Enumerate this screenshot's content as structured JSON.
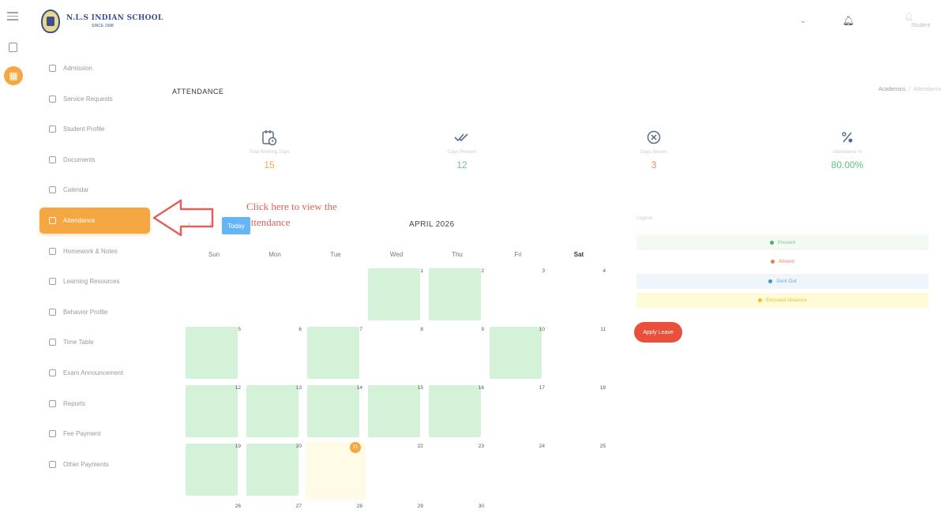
{
  "school": {
    "name": "N.L.S INDIAN SCHOOL",
    "subtitle": "SINCE 1998"
  },
  "topbar": {
    "caret": "⌄",
    "user_name": "Student"
  },
  "sidebar": {
    "items": [
      {
        "label": "Admission",
        "icon": "admission-icon",
        "active": false
      },
      {
        "label": "Service Requests",
        "icon": "service-icon",
        "active": false
      },
      {
        "label": "Student Profile",
        "icon": "profile-icon",
        "active": false
      },
      {
        "label": "Documents",
        "icon": "documents-icon",
        "active": false
      },
      {
        "label": "Calendar",
        "icon": "calendar-icon",
        "active": false
      },
      {
        "label": "Attendance",
        "icon": "attendance-icon",
        "active": true
      },
      {
        "label": "Homework & Notes",
        "icon": "homework-icon",
        "active": false
      },
      {
        "label": "Learning Resources",
        "icon": "resources-icon",
        "active": false
      },
      {
        "label": "Behavior Profile",
        "icon": "behavior-icon",
        "active": false
      },
      {
        "label": "Time Table",
        "icon": "timetable-icon",
        "active": false
      },
      {
        "label": "Exam Announcement",
        "icon": "exam-icon",
        "active": false
      },
      {
        "label": "Reports",
        "icon": "reports-icon",
        "active": false
      },
      {
        "label": "Fee Payment",
        "icon": "fee-icon",
        "active": false
      },
      {
        "label": "Other Payments",
        "icon": "payments-icon",
        "active": false
      }
    ]
  },
  "annotation": {
    "text": "Click here to view the attendance"
  },
  "page": {
    "title": "ATTENDANCE"
  },
  "breadcrumb": {
    "items": [
      "Academics",
      "Attendance"
    ]
  },
  "stats": [
    {
      "label": "Total Working Days",
      "value": "15",
      "color": "#f5a841",
      "icon": "calendar-clock-icon"
    },
    {
      "label": "Days Present",
      "value": "12",
      "color": "#6cc4a0",
      "icon": "double-check-icon"
    },
    {
      "label": "Days Absent",
      "value": "3",
      "color": "#f08a4b",
      "icon": "close-circle-icon"
    },
    {
      "label": "Attendance %",
      "value": "80.00%",
      "color": "#5dc27a",
      "icon": "percent-icon"
    }
  ],
  "calendar": {
    "today_label": "Today",
    "nav": "‹ ›",
    "month_title": "APRIL 2026",
    "weekdays": [
      "Sun",
      "Mon",
      "Tue",
      "Wed",
      "Thu",
      "Fri",
      "Sat"
    ],
    "today_date": 21,
    "present_days": [
      1,
      2,
      5,
      7,
      10,
      12,
      13,
      14,
      15,
      16,
      19,
      20
    ]
  },
  "legend": {
    "title": "Legend",
    "items": [
      {
        "label": "Present",
        "color": "#4caf63"
      },
      {
        "label": "Absent",
        "color": "#f07a4a"
      },
      {
        "label": "Sent Out",
        "color": "#3f97d6"
      },
      {
        "label": "Excused Absence",
        "color": "#f2c31f"
      }
    ]
  },
  "apply_leave": {
    "label": "Apply Leave"
  }
}
